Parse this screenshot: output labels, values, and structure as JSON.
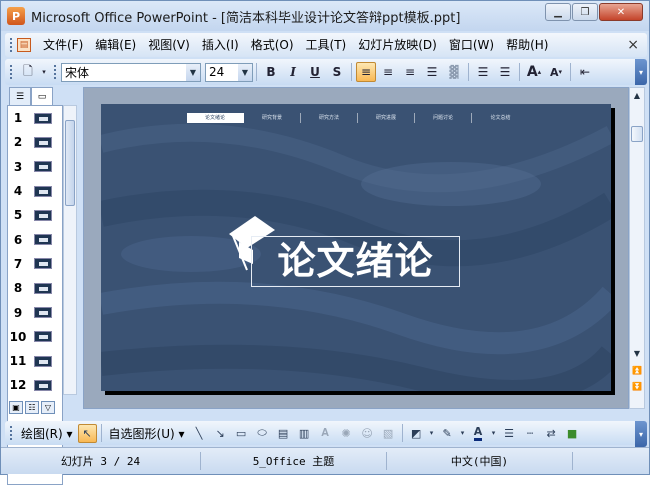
{
  "window": {
    "title": "Microsoft Office PowerPoint - [简洁本科毕业设计论文答辩ppt模板.ppt]",
    "app_icon": "P"
  },
  "menu": {
    "items": [
      "文件(F)",
      "编辑(E)",
      "视图(V)",
      "插入(I)",
      "格式(O)",
      "工具(T)",
      "幻灯片放映(D)",
      "窗口(W)",
      "帮助(H)"
    ],
    "close": "×"
  },
  "format_toolbar": {
    "font_name": "宋体",
    "font_size": "24",
    "bold": "B",
    "italic": "I",
    "underline": "U",
    "shadow": "S",
    "grow_font": "A",
    "shrink_font": "A"
  },
  "slides_pane": {
    "slide_numbers": [
      "1",
      "2",
      "3",
      "4",
      "5",
      "6",
      "7",
      "8",
      "9",
      "10",
      "11",
      "12"
    ],
    "selected_slide": "3"
  },
  "slide": {
    "nav_items": [
      "论文绪论",
      "研究背景",
      "研究方法",
      "研究进展",
      "问题讨论",
      "论文总结"
    ],
    "title": "论文绪论",
    "bg_color": "#3a5273"
  },
  "draw_toolbar": {
    "draw_label": "绘图(R)",
    "autoshapes_label": "自选图形(U)"
  },
  "status": {
    "slide_position": "幻灯片 3 / 24",
    "theme": "5_Office 主题",
    "language": "中文(中国)"
  },
  "colors": {
    "accent": "#f9b854",
    "chrome": "#cfe0f5"
  }
}
